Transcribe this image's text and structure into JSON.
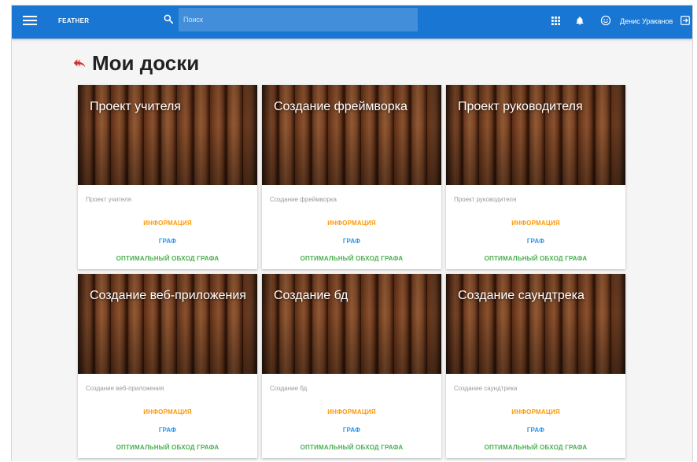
{
  "header": {
    "brand": "FEATHER",
    "search_placeholder": "Поиск",
    "user_name": "Денис Ураканов"
  },
  "page": {
    "title": "Мои доски"
  },
  "actions": {
    "info": "ИНФОРМАЦИЯ",
    "graph": "ГРАФ",
    "optimal": "ОПТИМАЛЬНЫЙ ОБХОД ГРАФА"
  },
  "boards": [
    {
      "title": "Проект учителя",
      "subtitle": "Проект учителя"
    },
    {
      "title": "Создание фреймворка",
      "subtitle": "Создание фреймворка"
    },
    {
      "title": "Проект руководителя",
      "subtitle": "Проект руководителя"
    },
    {
      "title": "Создание веб-приложения",
      "subtitle": "Создание веб-приложения"
    },
    {
      "title": "Создание бд",
      "subtitle": "Создание бд"
    },
    {
      "title": "Создание саундтрека",
      "subtitle": "Создание саундтрека"
    }
  ],
  "colors": {
    "appbar": "#1976d2",
    "info": "#ff9800",
    "graph": "#2196f3",
    "optimal": "#4caf50",
    "back_arrow": "#d32f2f"
  },
  "icons": [
    "menu-icon",
    "search-icon",
    "apps-icon",
    "bell-icon",
    "face-icon",
    "logout-icon",
    "back-arrow-icon"
  ]
}
